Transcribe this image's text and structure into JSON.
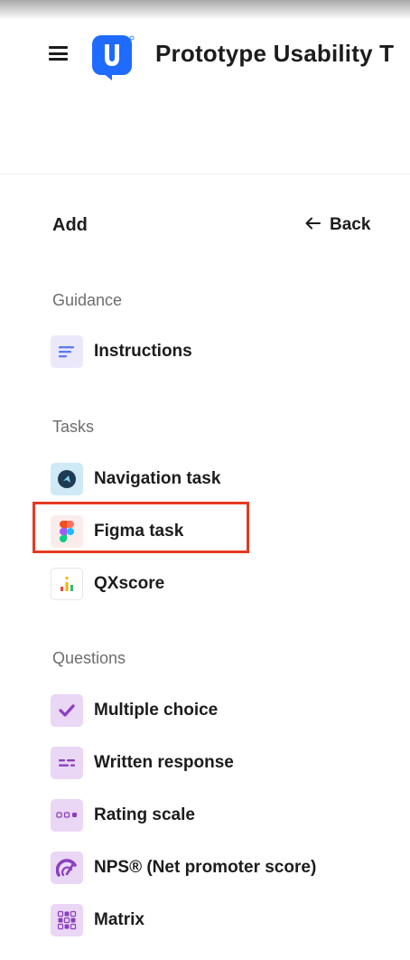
{
  "header": {
    "app_title": "Prototype Usability T",
    "logo_letter": "U"
  },
  "panel": {
    "title": "Add",
    "back_label": "Back"
  },
  "sections": {
    "guidance": "Guidance",
    "tasks": "Tasks",
    "questions": "Questions"
  },
  "items": {
    "instructions": "Instructions",
    "navigation_task": "Navigation task",
    "figma_task": "Figma task",
    "qxscore": "QXscore",
    "multiple_choice": "Multiple choice",
    "written_response": "Written response",
    "rating_scale": "Rating scale",
    "nps": "NPS® (Net promoter score)",
    "matrix": "Matrix"
  },
  "colors": {
    "brand_blue": "#1f6bff",
    "highlight_red": "#e53a23",
    "icon_purple": "#8a3fc0"
  }
}
